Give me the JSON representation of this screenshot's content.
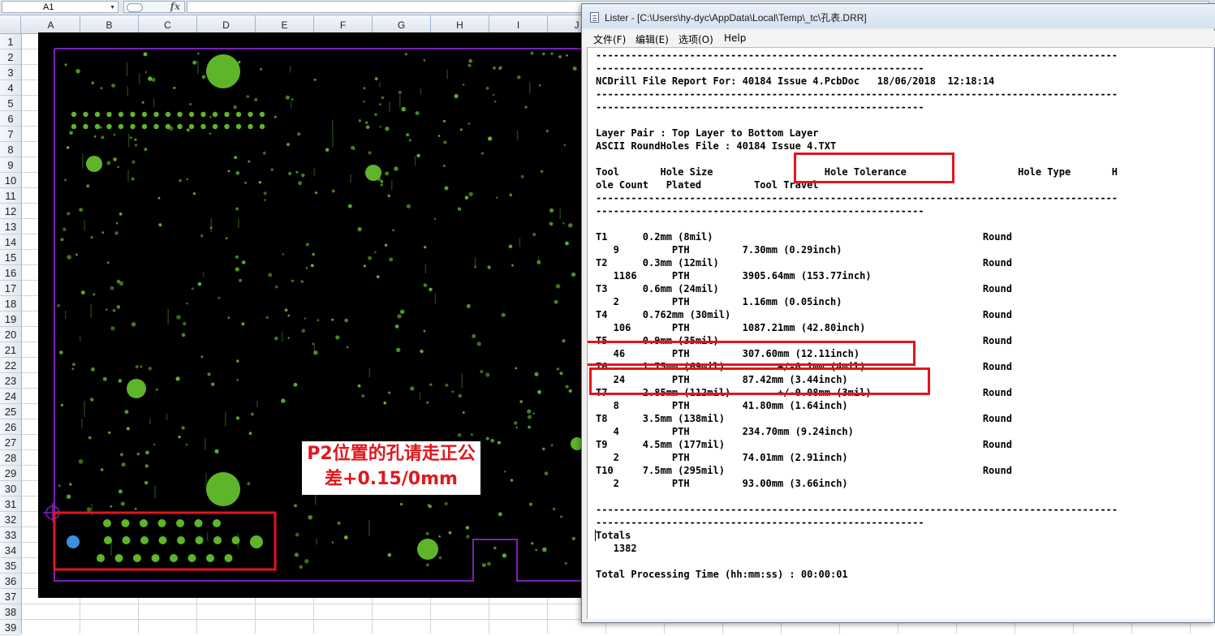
{
  "excel": {
    "name_box": "A1",
    "fx_label": "fx",
    "columns": [
      "A",
      "B",
      "C",
      "D",
      "E",
      "F",
      "G",
      "H",
      "I",
      "J"
    ],
    "rows": [
      "1",
      "2",
      "3",
      "4",
      "5",
      "6",
      "7",
      "8",
      "9",
      "10",
      "11",
      "12",
      "13",
      "14",
      "15",
      "16",
      "17",
      "18",
      "19",
      "20",
      "21",
      "22",
      "23",
      "24",
      "25",
      "26",
      "27",
      "28",
      "29",
      "30",
      "31",
      "32",
      "33",
      "34",
      "35",
      "36",
      "37",
      "38",
      "39"
    ]
  },
  "pcb": {
    "callout_line1": "P2位置的孔请走正公",
    "callout_line2": "差+0.15/0mm",
    "colors": {
      "background": "#000000",
      "pad": "#5fb52a",
      "outline": "#7a22b8",
      "highlight": "#e4141c",
      "blue_pad": "#3d8fe0"
    }
  },
  "lister": {
    "title": "Lister - [C:\\Users\\hy-dyc\\AppData\\Local\\Temp\\_tc\\孔表.DRR]",
    "menu": [
      "文件(F)",
      "编辑(E)",
      "选项(O)",
      "Help"
    ],
    "lines": [
      "-----------------------------------------------------------------------------------------",
      "--------------------------------------------------------",
      "NCDrill File Report For: 40184 Issue 4.PcbDoc   18/06/2018  12:18:14",
      "-----------------------------------------------------------------------------------------",
      "--------------------------------------------------------",
      "",
      "Layer Pair : Top Layer to Bottom Layer",
      "ASCII RoundHoles File : 40184 Issue 4.TXT",
      "",
      "Tool       Hole Size                   Hole Tolerance                   Hole Type       H",
      "ole Count   Plated         Tool Travel",
      "-----------------------------------------------------------------------------------------",
      "--------------------------------------------------------",
      "",
      "T1      0.2mm (8mil)                                              Round",
      "   9         PTH         7.30mm (0.29inch)",
      "T2      0.3mm (12mil)                                             Round",
      "   1186      PTH         3905.64mm (153.77inch)",
      "T3      0.6mm (24mil)                                             Round",
      "   2         PTH         1.16mm (0.05inch)",
      "T4      0.762mm (30mil)                                           Round",
      "   106       PTH         1087.21mm (42.80inch)",
      "T5      0.9mm (35mil)                                             Round",
      "   46        PTH         307.60mm (12.11inch)",
      "T6      1.75mm (69mil)         +/-0.1mm (4mil)                    Round",
      "   24        PTH         87.42mm (3.44inch)",
      "T7      2.85mm (112mil)        +/-0.08mm (3mil)                   Round",
      "   8         PTH         41.80mm (1.64inch)",
      "T8      3.5mm (138mil)                                            Round",
      "   4         PTH         234.70mm (9.24inch)",
      "T9      4.5mm (177mil)                                            Round",
      "   2         PTH         74.01mm (2.91inch)",
      "T10     7.5mm (295mil)                                            Round",
      "   2         PTH         93.00mm (3.66inch)",
      "",
      "-----------------------------------------------------------------------------------------",
      "--------------------------------------------------------",
      "Totals",
      "   1382",
      "",
      "Total Processing Time (hh:mm:ss) : 00:00:01"
    ]
  }
}
